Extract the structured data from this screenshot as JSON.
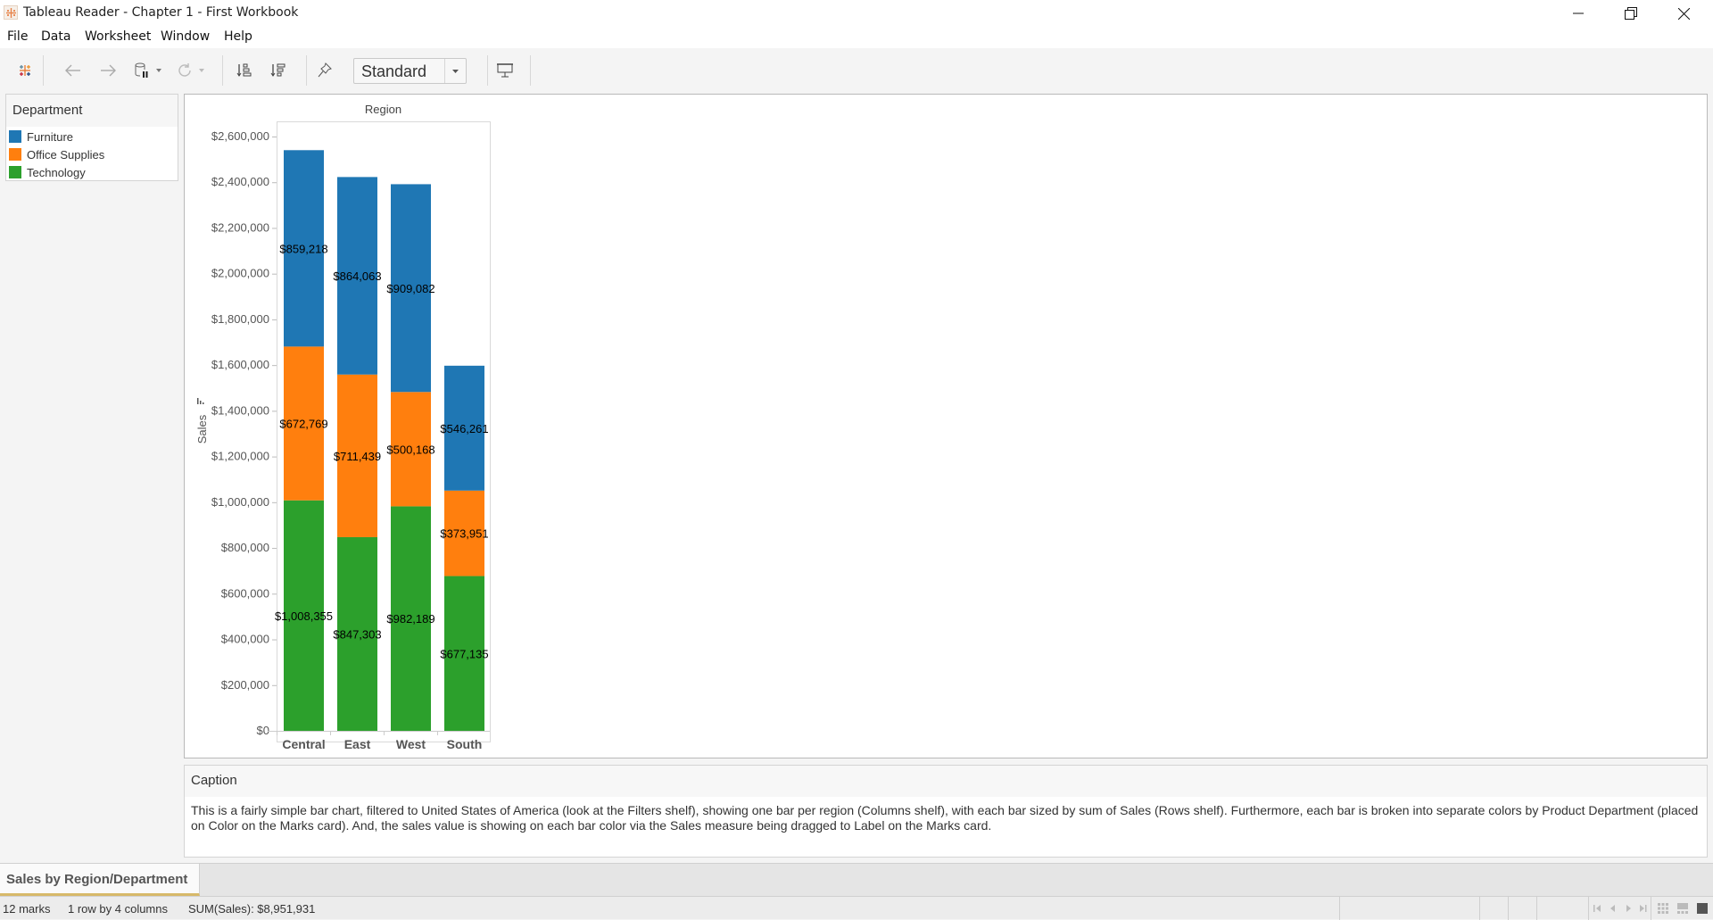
{
  "window": {
    "title": "Tableau Reader - Chapter 1 - First Workbook",
    "controls": [
      "minimize",
      "restore",
      "close"
    ]
  },
  "menu": [
    "File",
    "Data",
    "Worksheet",
    "Window",
    "Help"
  ],
  "toolbar": {
    "icons": [
      "tableau-logo-icon",
      "undo-icon",
      "redo-icon",
      "pause-data-source-icon",
      "refresh-icon",
      "sort-ascending-icon",
      "sort-descending-icon",
      "pin-icon",
      "presentation-mode-icon"
    ],
    "fit_value": "Standard"
  },
  "legend": {
    "title": "Department",
    "items": [
      {
        "label": "Furniture",
        "color": "#1f77b4"
      },
      {
        "label": "Office Supplies",
        "color": "#ff7f0e"
      },
      {
        "label": "Technology",
        "color": "#2ca02c"
      }
    ]
  },
  "chart_data": {
    "type": "bar",
    "stacked": true,
    "title": "",
    "column_header": "Region",
    "xlabel": "",
    "ylabel": "Sales",
    "categories": [
      "Central",
      "East",
      "West",
      "South"
    ],
    "series": [
      {
        "name": "Technology",
        "color": "#2ca02c",
        "values": [
          1008355,
          847303,
          982189,
          677135
        ],
        "labels": [
          "$1,008,355",
          "$847,303",
          "$982,189",
          "$677,135"
        ]
      },
      {
        "name": "Office Supplies",
        "color": "#ff7f0e",
        "values": [
          672769,
          711439,
          500168,
          373951
        ],
        "labels": [
          "$672,769",
          "$711,439",
          "$500,168",
          "$373,951"
        ]
      },
      {
        "name": "Furniture",
        "color": "#1f77b4",
        "values": [
          859218,
          864063,
          909082,
          546261
        ],
        "labels": [
          "$859,218",
          "$864,063",
          "$909,082",
          "$546,261"
        ]
      }
    ],
    "ylim": [
      0,
      2600000
    ],
    "yticks": [
      0,
      200000,
      400000,
      600000,
      800000,
      1000000,
      1200000,
      1400000,
      1600000,
      1800000,
      2000000,
      2200000,
      2400000,
      2600000
    ],
    "ytick_labels": [
      "$0",
      "$200,000",
      "$400,000",
      "$600,000",
      "$800,000",
      "$1,000,000",
      "$1,200,000",
      "$1,400,000",
      "$1,600,000",
      "$1,800,000",
      "$2,000,000",
      "$2,200,000",
      "$2,400,000",
      "$2,600,000"
    ],
    "grid": false,
    "legend": "left-panel"
  },
  "caption": {
    "title": "Caption",
    "text": "This is a fairly simple bar chart, filtered to United States of America (look at the Filters shelf), showing one bar per region (Columns shelf), with each bar sized by sum of Sales (Rows shelf). Furthermore, each bar is broken into separate colors by Product Department (placed on Color on the Marks card). And, the sales value is showing on each bar color via the Sales measure being dragged to Label on the Marks card."
  },
  "sheet_tabs": [
    {
      "label": "Sales by Region/Department",
      "active": true
    }
  ],
  "status": {
    "marks": "12 marks",
    "dims": "1 row by 4 columns",
    "sum": "SUM(Sales): $8,951,931"
  }
}
